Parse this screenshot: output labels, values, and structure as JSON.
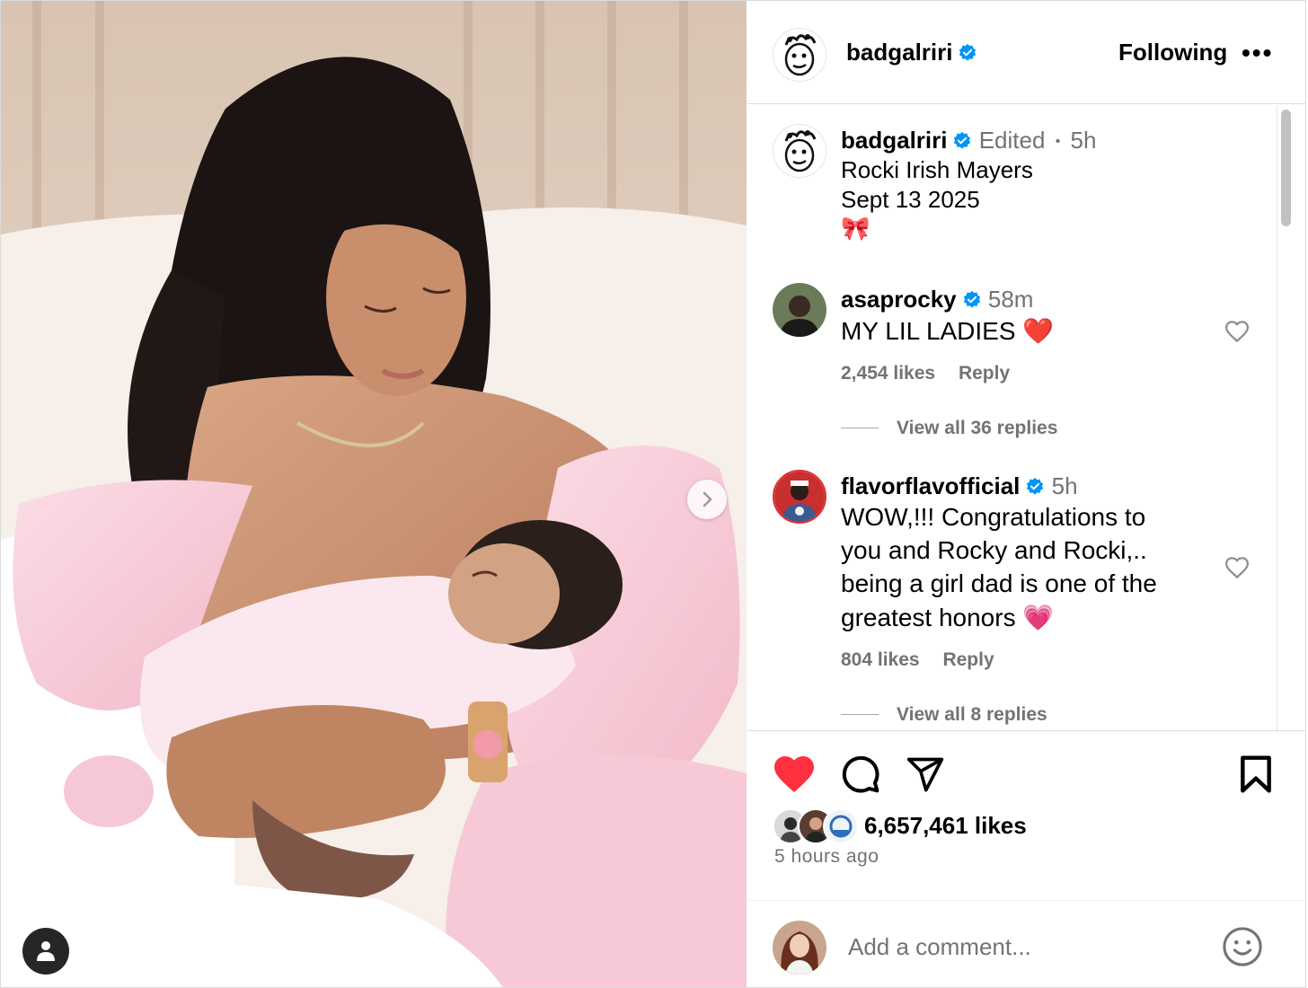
{
  "post": {
    "author": "badgalriri",
    "follow_label": "Following",
    "more_label": "•••",
    "carousel": {
      "slide_count": 2,
      "current": 1
    }
  },
  "caption": {
    "username": "badgalriri",
    "edited": "Edited",
    "separator": "•",
    "time": "5h",
    "lines": [
      "Rocki Irish Mayers",
      "Sept 13 2025",
      "🎀"
    ]
  },
  "comments": [
    {
      "username": "asaprocky",
      "time": "58m",
      "lines": [
        "MY LIL LADIES ❤️"
      ],
      "likes": "2,454 likes",
      "reply": "Reply",
      "view_replies": "View all 36 replies"
    },
    {
      "username": "flavorflavofficial",
      "time": "5h",
      "lines": [
        "WOW,!!! Congratulations to",
        "you and Rocky and Rocki,..",
        "being a girl dad is one of the",
        "greatest honors 💗"
      ],
      "likes": "804 likes",
      "reply": "Reply",
      "view_replies": "View all 8 replies"
    }
  ],
  "footer": {
    "likes": "6,657,461 likes",
    "time_ago": "5 hours ago",
    "liked": true,
    "add_comment_placeholder": "Add a comment..."
  },
  "icons": {
    "verified": "verified-badge-icon",
    "like": "heart-icon",
    "comment": "comment-bubble-icon",
    "share": "paper-plane-icon",
    "save": "bookmark-icon",
    "emoji": "smiley-icon",
    "tag": "user-tag-icon",
    "next": "chevron-right-icon"
  },
  "colors": {
    "like_red": "#ff3040",
    "verified_blue": "#0095f6",
    "secondary_text": "#737373",
    "border": "#dbdbdb"
  }
}
